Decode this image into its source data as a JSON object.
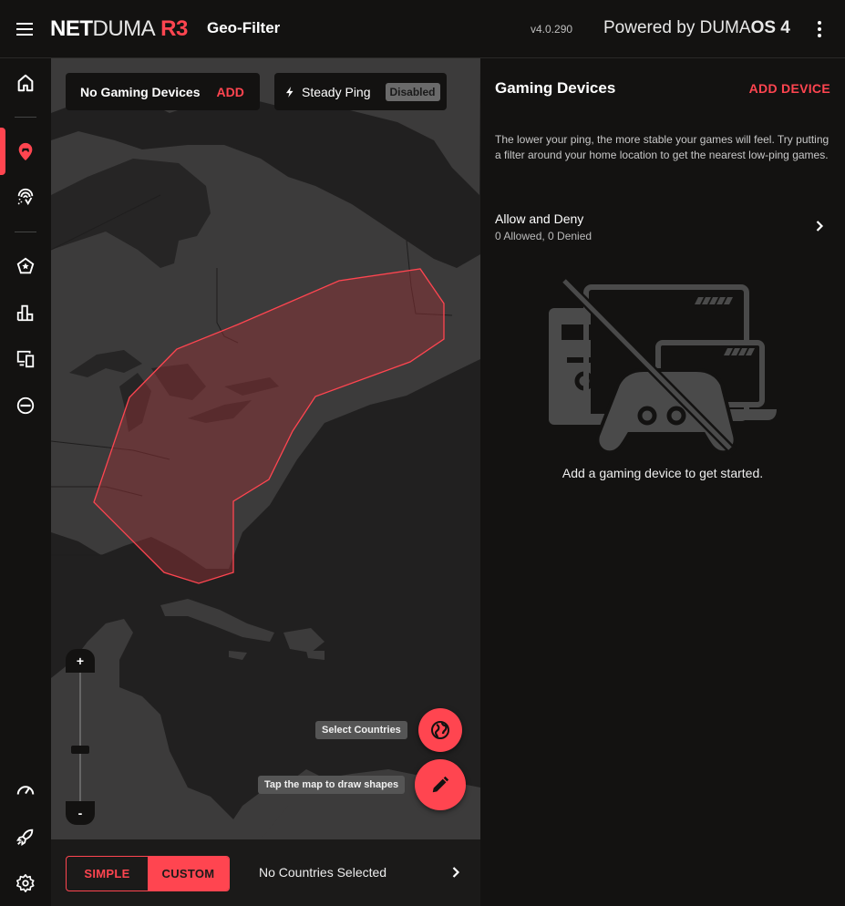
{
  "header": {
    "logo_net": "NET",
    "logo_duma": "DUMA",
    "logo_model": "R3",
    "page_title": "Geo-Filter",
    "version": "v4.0.290",
    "powered_prefix": "Powered by DUMA",
    "powered_suffix": "OS 4"
  },
  "sidebar": {
    "items": [
      {
        "id": "home",
        "icon": "home-icon"
      },
      {
        "id": "geo-filter",
        "icon": "geo-filter-icon",
        "active": true
      },
      {
        "id": "ping-heatmap",
        "icon": "ping-icon"
      },
      {
        "id": "prioritization",
        "icon": "star-pentagon-icon"
      },
      {
        "id": "network-monitor",
        "icon": "bar-chart-icon"
      },
      {
        "id": "devices",
        "icon": "devices-icon"
      },
      {
        "id": "blocker",
        "icon": "blocker-icon"
      },
      {
        "id": "speed-test",
        "icon": "speedometer-icon"
      },
      {
        "id": "boost",
        "icon": "rocket-icon"
      },
      {
        "id": "settings",
        "icon": "gear-icon"
      }
    ]
  },
  "map": {
    "devices_chip": {
      "label": "No Gaming Devices",
      "action": "ADD"
    },
    "steady_ping_chip": {
      "label": "Steady Ping",
      "status": "Disabled"
    },
    "zoom": {
      "plus": "+",
      "minus": "-"
    },
    "fab_select_countries_tip": "Select Countries",
    "fab_draw_tip": "Tap the map to draw shapes",
    "filter_region_color": "#ff4550"
  },
  "bottom_bar": {
    "mode_simple": "SIMPLE",
    "mode_custom": "CUSTOM",
    "active_mode": "CUSTOM",
    "countries_status": "No Countries Selected"
  },
  "panel": {
    "title": "Gaming Devices",
    "add_device": "ADD DEVICE",
    "description": "The lower your ping, the more stable your games will feel. Try putting a filter around your home location to get the nearest low-ping games.",
    "allow_deny_title": "Allow and Deny",
    "allow_deny_summary": "0 Allowed, 0 Denied",
    "empty_message": "Add a gaming device to get started."
  },
  "colors": {
    "accent": "#ff4550",
    "background": "#131211",
    "map_water": "#212020",
    "map_land": "#3c3b3b"
  }
}
